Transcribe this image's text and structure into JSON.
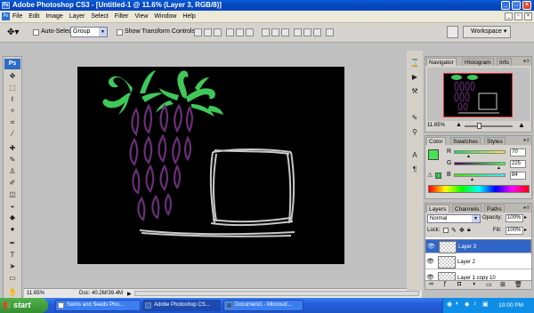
{
  "window": {
    "title": "Adobe Photoshop CS3 - [Untitled-1 @ 11.6% (Layer 3, RGB/8)]"
  },
  "menu": [
    "File",
    "Edit",
    "Image",
    "Layer",
    "Select",
    "Filter",
    "View",
    "Window",
    "Help"
  ],
  "options": {
    "auto_select_label": "Auto-Select:",
    "auto_select_value": "Group",
    "show_transform_label": "Show Transform Controls",
    "workspace_label": "Workspace"
  },
  "toolbox": {
    "logo": "Ps"
  },
  "status": {
    "zoom": "11.65%",
    "doc": "Doc: 40.2M/39.4M"
  },
  "navigator": {
    "tabs": [
      "Navigator",
      "Histogram",
      "Info"
    ],
    "zoom": "11.65%"
  },
  "color": {
    "tabs": [
      "Color",
      "Swatches",
      "Styles"
    ],
    "r_label": "R",
    "g_label": "G",
    "b_label": "B",
    "r": "70",
    "g": "225",
    "b": "84",
    "swatch": "#46e154"
  },
  "layers": {
    "tabs": [
      "Layers",
      "Channels",
      "Paths"
    ],
    "blend_mode": "Normal",
    "opacity_label": "Opacity:",
    "opacity": "100%",
    "lock_label": "Lock:",
    "fill_label": "Fill:",
    "fill": "100%",
    "items": [
      "Layer 3",
      "Layer 2",
      "Layer 1 copy 10"
    ]
  },
  "taskbar": {
    "start": "start",
    "tasks": [
      "Swirls and Seeds Pho...",
      "Adobe Photoshop CS...",
      "Document1 - Microsof..."
    ],
    "clock": "10:00 PM"
  },
  "colors": {
    "accent": "#3166c6",
    "leaf_green": "#3fc85a",
    "seed_purple": "#6a2f78"
  }
}
